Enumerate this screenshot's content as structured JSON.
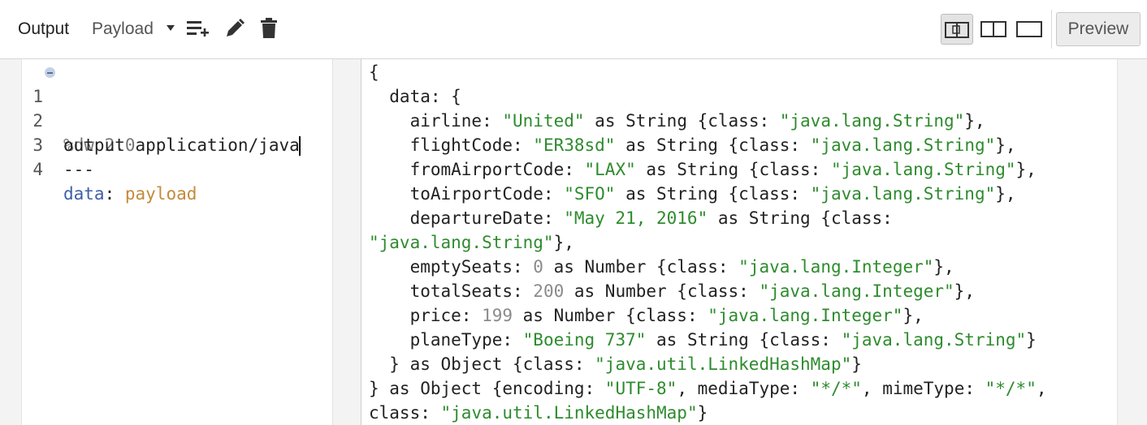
{
  "toolbar": {
    "output_label": "Output",
    "payload_label": "Payload",
    "preview_label": "Preview"
  },
  "editor": {
    "lines": [
      {
        "num": "1",
        "header": "%dw 2.0"
      },
      {
        "num": "2",
        "text": "output application/java"
      },
      {
        "num": "3",
        "text": "---"
      },
      {
        "num": "4",
        "key": "data",
        "colon": ": ",
        "value": "payload"
      }
    ]
  },
  "output": {
    "l1": "{",
    "l2_key": "  data: {",
    "airline": {
      "k": "    airline: ",
      "v": "\"United\"",
      "t": " as String {class: ",
      "c": "\"java.lang.String\"",
      "e": "},"
    },
    "flightCode": {
      "k": "    flightCode: ",
      "v": "\"ER38sd\"",
      "t": " as String {class: ",
      "c": "\"java.lang.String\"",
      "e": "},"
    },
    "fromAirportCode": {
      "k": "    fromAirportCode: ",
      "v": "\"LAX\"",
      "t": " as String {class: ",
      "c": "\"java.lang.String\"",
      "e": "},"
    },
    "toAirportCode": {
      "k": "    toAirportCode: ",
      "v": "\"SFO\"",
      "t": " as String {class: ",
      "c": "\"java.lang.String\"",
      "e": "},"
    },
    "departureDate": {
      "k": "    departureDate: ",
      "v": "\"May 21, 2016\"",
      "t": " as String {class:",
      "c2": "\"java.lang.String\"",
      "e": "},"
    },
    "emptySeats": {
      "k": "    emptySeats: ",
      "v": "0",
      "t": " as Number {class: ",
      "c": "\"java.lang.Integer\"",
      "e": "},"
    },
    "totalSeats": {
      "k": "    totalSeats: ",
      "v": "200",
      "t": " as Number {class: ",
      "c": "\"java.lang.Integer\"",
      "e": "},"
    },
    "price": {
      "k": "    price: ",
      "v": "199",
      "t": " as Number {class: ",
      "c": "\"java.lang.Integer\"",
      "e": "},"
    },
    "planeType": {
      "k": "    planeType: ",
      "v": "\"Boeing 737\"",
      "t": " as String {class: ",
      "c": "\"java.lang.String\"",
      "e": "}"
    },
    "inner_close": {
      "t": "  } as Object {class: ",
      "c": "\"java.util.LinkedHashMap\"",
      "e": "}"
    },
    "outer_close": {
      "t1": "} as Object {encoding: ",
      "enc": "\"UTF-8\"",
      "t2": ", mediaType: ",
      "mt": "\"*/*\"",
      "t3": ", mimeType: ",
      "mime": "\"*/*\"",
      "t4": ",",
      "t5": "class: ",
      "cls": "\"java.util.LinkedHashMap\"",
      "e": "}"
    }
  }
}
